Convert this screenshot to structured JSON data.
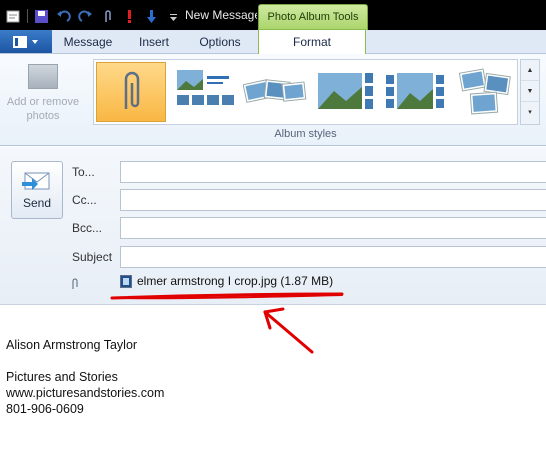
{
  "titlebar": {
    "title": "New Message",
    "context_tab_group": "Photo Album Tools"
  },
  "qat": {
    "icons": [
      "app-icon",
      "save-icon",
      "undo-icon",
      "redo-icon",
      "attach-icon",
      "high-importance-icon",
      "low-importance-icon",
      "customize-icon"
    ]
  },
  "tabs": {
    "message": "Message",
    "insert": "Insert",
    "options": "Options",
    "format": "Format"
  },
  "ribbon": {
    "add_remove_photos": "Add or remove photos",
    "gallery_group_label": "Album styles",
    "styles": [
      "paperclip",
      "grid-caption",
      "fanned",
      "filmstrip-right",
      "filmstrip-side",
      "stacked"
    ]
  },
  "header": {
    "send": "Send",
    "to_label": "To...",
    "cc_label": "Cc...",
    "bcc_label": "Bcc...",
    "subject_label": "Subject",
    "attachment": "elmer armstrong I crop.jpg (1.87 MB)"
  },
  "body": {
    "name": "Alison Armstrong Taylor",
    "company": "Pictures and Stories",
    "website": "www.picturesandstories.com",
    "phone": "801-906-0609"
  },
  "colors": {
    "context_tab": "#a9d46a",
    "selected_style": "#f9b744",
    "annotation": "#e00000"
  }
}
